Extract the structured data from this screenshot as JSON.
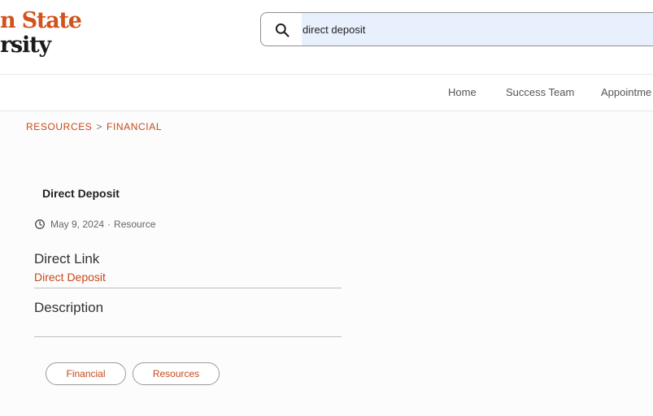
{
  "header": {
    "logo_line1": "n State",
    "logo_line2": "rsity"
  },
  "search": {
    "value": "direct deposit",
    "icon": "search-icon"
  },
  "nav": {
    "items": [
      {
        "label": "Home"
      },
      {
        "label": "Success Team"
      },
      {
        "label": "Appointme"
      }
    ]
  },
  "breadcrumb": {
    "parent": "RESOURCES",
    "separator": ">",
    "current": "FINANCIAL"
  },
  "article": {
    "title": "Direct Deposit",
    "date": "May 9, 2024",
    "meta_separator": "·",
    "type": "Resource",
    "direct_link_heading": "Direct Link",
    "direct_link_text": "Direct Deposit",
    "description_heading": "Description",
    "tags": [
      "Financial",
      "Resources"
    ]
  },
  "colors": {
    "accent": "#c5491a",
    "logo_orange": "#d1521c"
  }
}
